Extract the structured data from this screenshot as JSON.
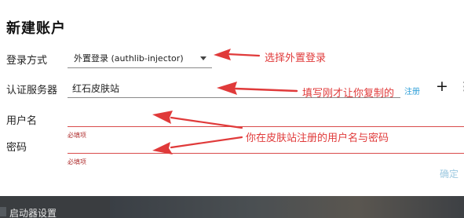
{
  "dialog": {
    "title": "新建账户",
    "login_method": {
      "label": "登录方式",
      "value": "外置登录 (authlib-injector)"
    },
    "auth_server": {
      "label": "认证服务器",
      "value": "红石皮肤站",
      "register_link": "注册",
      "add_icon": "+"
    },
    "username": {
      "label": "用户名",
      "value": "",
      "required_hint": "必填项"
    },
    "password": {
      "label": "密码",
      "value": "",
      "required_hint": "必填项"
    },
    "confirm_label": "确定"
  },
  "annotations": {
    "login_method_note": "选择外置登录",
    "auth_server_note": "填写刚才让你复制的",
    "credentials_note": "你在皮肤站注册的用户名与密码"
  },
  "bottom_bar": {
    "label": "启动器设置"
  },
  "colors": {
    "annotation": "#e03a3a",
    "link": "#2f9fd8",
    "error_underline": "#d94b4b",
    "confirm_disabled": "#9cc8e0"
  }
}
